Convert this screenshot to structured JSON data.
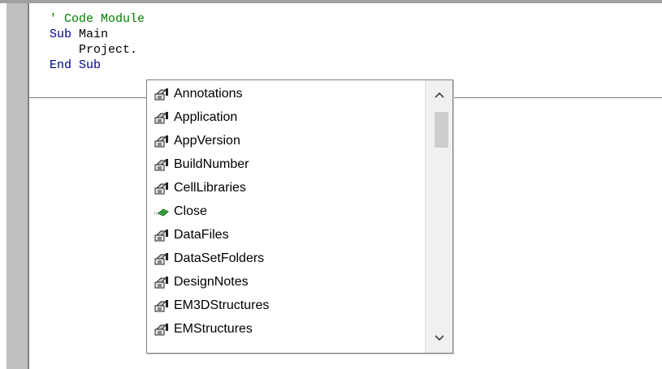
{
  "code": {
    "lines": [
      {
        "tokens": [
          {
            "text": "' Code Module",
            "cls": "cm"
          }
        ]
      },
      {
        "tokens": [
          {
            "text": "Sub",
            "cls": "kw"
          },
          {
            "text": " Main",
            "cls": ""
          }
        ]
      },
      {
        "tokens": [
          {
            "text": "    Project.",
            "cls": ""
          }
        ]
      },
      {
        "tokens": [
          {
            "text": "End Sub",
            "cls": "kw"
          }
        ]
      }
    ]
  },
  "autocomplete": {
    "items": [
      {
        "label": "Annotations",
        "icon": "property-icon"
      },
      {
        "label": "Application",
        "icon": "property-icon"
      },
      {
        "label": "AppVersion",
        "icon": "property-icon"
      },
      {
        "label": "BuildNumber",
        "icon": "property-icon"
      },
      {
        "label": "CellLibraries",
        "icon": "property-icon"
      },
      {
        "label": "Close",
        "icon": "method-icon"
      },
      {
        "label": "DataFiles",
        "icon": "property-icon"
      },
      {
        "label": "DataSetFolders",
        "icon": "property-icon"
      },
      {
        "label": "DesignNotes",
        "icon": "property-icon"
      },
      {
        "label": "EM3DStructures",
        "icon": "property-icon"
      },
      {
        "label": "EMStructures",
        "icon": "property-icon"
      }
    ],
    "scroll_up_glyph": "^",
    "scroll_down_glyph": "v",
    "scroll_position": 0.0
  },
  "colors": {
    "keyword": "#00008b",
    "comment": "#008000",
    "gutter": "#c0c0c0"
  }
}
